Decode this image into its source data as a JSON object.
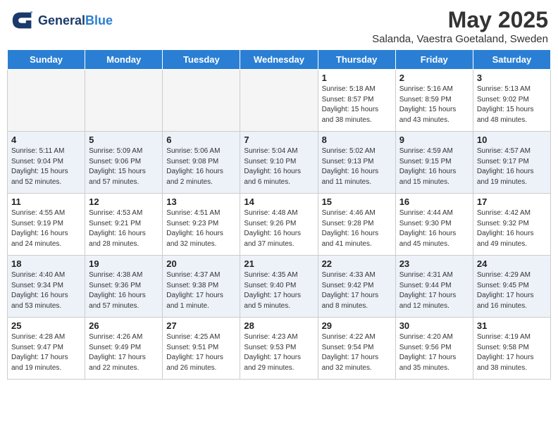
{
  "header": {
    "logo_general": "General",
    "logo_blue": "Blue",
    "month": "May 2025",
    "location": "Salanda, Vaestra Goetaland, Sweden"
  },
  "weekdays": [
    "Sunday",
    "Monday",
    "Tuesday",
    "Wednesday",
    "Thursday",
    "Friday",
    "Saturday"
  ],
  "weeks": [
    [
      {
        "day": "",
        "info": ""
      },
      {
        "day": "",
        "info": ""
      },
      {
        "day": "",
        "info": ""
      },
      {
        "day": "",
        "info": ""
      },
      {
        "day": "1",
        "info": "Sunrise: 5:18 AM\nSunset: 8:57 PM\nDaylight: 15 hours\nand 38 minutes."
      },
      {
        "day": "2",
        "info": "Sunrise: 5:16 AM\nSunset: 8:59 PM\nDaylight: 15 hours\nand 43 minutes."
      },
      {
        "day": "3",
        "info": "Sunrise: 5:13 AM\nSunset: 9:02 PM\nDaylight: 15 hours\nand 48 minutes."
      }
    ],
    [
      {
        "day": "4",
        "info": "Sunrise: 5:11 AM\nSunset: 9:04 PM\nDaylight: 15 hours\nand 52 minutes."
      },
      {
        "day": "5",
        "info": "Sunrise: 5:09 AM\nSunset: 9:06 PM\nDaylight: 15 hours\nand 57 minutes."
      },
      {
        "day": "6",
        "info": "Sunrise: 5:06 AM\nSunset: 9:08 PM\nDaylight: 16 hours\nand 2 minutes."
      },
      {
        "day": "7",
        "info": "Sunrise: 5:04 AM\nSunset: 9:10 PM\nDaylight: 16 hours\nand 6 minutes."
      },
      {
        "day": "8",
        "info": "Sunrise: 5:02 AM\nSunset: 9:13 PM\nDaylight: 16 hours\nand 11 minutes."
      },
      {
        "day": "9",
        "info": "Sunrise: 4:59 AM\nSunset: 9:15 PM\nDaylight: 16 hours\nand 15 minutes."
      },
      {
        "day": "10",
        "info": "Sunrise: 4:57 AM\nSunset: 9:17 PM\nDaylight: 16 hours\nand 19 minutes."
      }
    ],
    [
      {
        "day": "11",
        "info": "Sunrise: 4:55 AM\nSunset: 9:19 PM\nDaylight: 16 hours\nand 24 minutes."
      },
      {
        "day": "12",
        "info": "Sunrise: 4:53 AM\nSunset: 9:21 PM\nDaylight: 16 hours\nand 28 minutes."
      },
      {
        "day": "13",
        "info": "Sunrise: 4:51 AM\nSunset: 9:23 PM\nDaylight: 16 hours\nand 32 minutes."
      },
      {
        "day": "14",
        "info": "Sunrise: 4:48 AM\nSunset: 9:26 PM\nDaylight: 16 hours\nand 37 minutes."
      },
      {
        "day": "15",
        "info": "Sunrise: 4:46 AM\nSunset: 9:28 PM\nDaylight: 16 hours\nand 41 minutes."
      },
      {
        "day": "16",
        "info": "Sunrise: 4:44 AM\nSunset: 9:30 PM\nDaylight: 16 hours\nand 45 minutes."
      },
      {
        "day": "17",
        "info": "Sunrise: 4:42 AM\nSunset: 9:32 PM\nDaylight: 16 hours\nand 49 minutes."
      }
    ],
    [
      {
        "day": "18",
        "info": "Sunrise: 4:40 AM\nSunset: 9:34 PM\nDaylight: 16 hours\nand 53 minutes."
      },
      {
        "day": "19",
        "info": "Sunrise: 4:38 AM\nSunset: 9:36 PM\nDaylight: 16 hours\nand 57 minutes."
      },
      {
        "day": "20",
        "info": "Sunrise: 4:37 AM\nSunset: 9:38 PM\nDaylight: 17 hours\nand 1 minute."
      },
      {
        "day": "21",
        "info": "Sunrise: 4:35 AM\nSunset: 9:40 PM\nDaylight: 17 hours\nand 5 minutes."
      },
      {
        "day": "22",
        "info": "Sunrise: 4:33 AM\nSunset: 9:42 PM\nDaylight: 17 hours\nand 8 minutes."
      },
      {
        "day": "23",
        "info": "Sunrise: 4:31 AM\nSunset: 9:44 PM\nDaylight: 17 hours\nand 12 minutes."
      },
      {
        "day": "24",
        "info": "Sunrise: 4:29 AM\nSunset: 9:45 PM\nDaylight: 17 hours\nand 16 minutes."
      }
    ],
    [
      {
        "day": "25",
        "info": "Sunrise: 4:28 AM\nSunset: 9:47 PM\nDaylight: 17 hours\nand 19 minutes."
      },
      {
        "day": "26",
        "info": "Sunrise: 4:26 AM\nSunset: 9:49 PM\nDaylight: 17 hours\nand 22 minutes."
      },
      {
        "day": "27",
        "info": "Sunrise: 4:25 AM\nSunset: 9:51 PM\nDaylight: 17 hours\nand 26 minutes."
      },
      {
        "day": "28",
        "info": "Sunrise: 4:23 AM\nSunset: 9:53 PM\nDaylight: 17 hours\nand 29 minutes."
      },
      {
        "day": "29",
        "info": "Sunrise: 4:22 AM\nSunset: 9:54 PM\nDaylight: 17 hours\nand 32 minutes."
      },
      {
        "day": "30",
        "info": "Sunrise: 4:20 AM\nSunset: 9:56 PM\nDaylight: 17 hours\nand 35 minutes."
      },
      {
        "day": "31",
        "info": "Sunrise: 4:19 AM\nSunset: 9:58 PM\nDaylight: 17 hours\nand 38 minutes."
      }
    ]
  ]
}
